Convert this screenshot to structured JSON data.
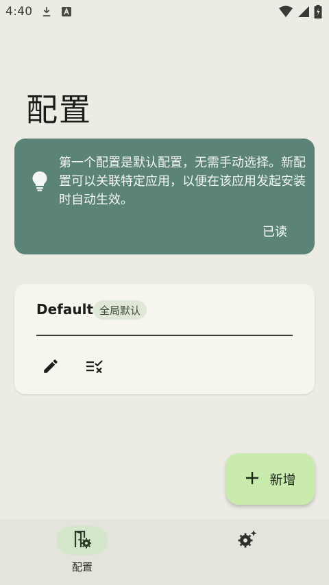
{
  "status_bar": {
    "time": "4:40",
    "left_icons": [
      "download-icon",
      "a-badge-icon"
    ],
    "right_icons": [
      "wifi-icon",
      "signal-icon",
      "battery-icon"
    ]
  },
  "header": {
    "title": "配置"
  },
  "tip_card": {
    "icon": "lightbulb-icon",
    "text": "第一个配置是默认配置，无需手动选择。新配置可以关联特定应用，以便在该应用发起安装时自动生效。",
    "action_label": "已读",
    "background_color": "#5b8378"
  },
  "profiles": [
    {
      "name": "Default",
      "badge": "全局默认",
      "actions": [
        "edit-icon",
        "checklist-clear-icon"
      ]
    }
  ],
  "fab": {
    "icon": "plus-icon",
    "label": "新增",
    "color": "#c9ebae"
  },
  "bottom_nav": {
    "items": [
      {
        "label": "配置",
        "icon": "config-door-gear-icon",
        "active": true
      },
      {
        "label": "",
        "icon": "settings-gear-sparkle-icon",
        "active": false
      }
    ]
  }
}
